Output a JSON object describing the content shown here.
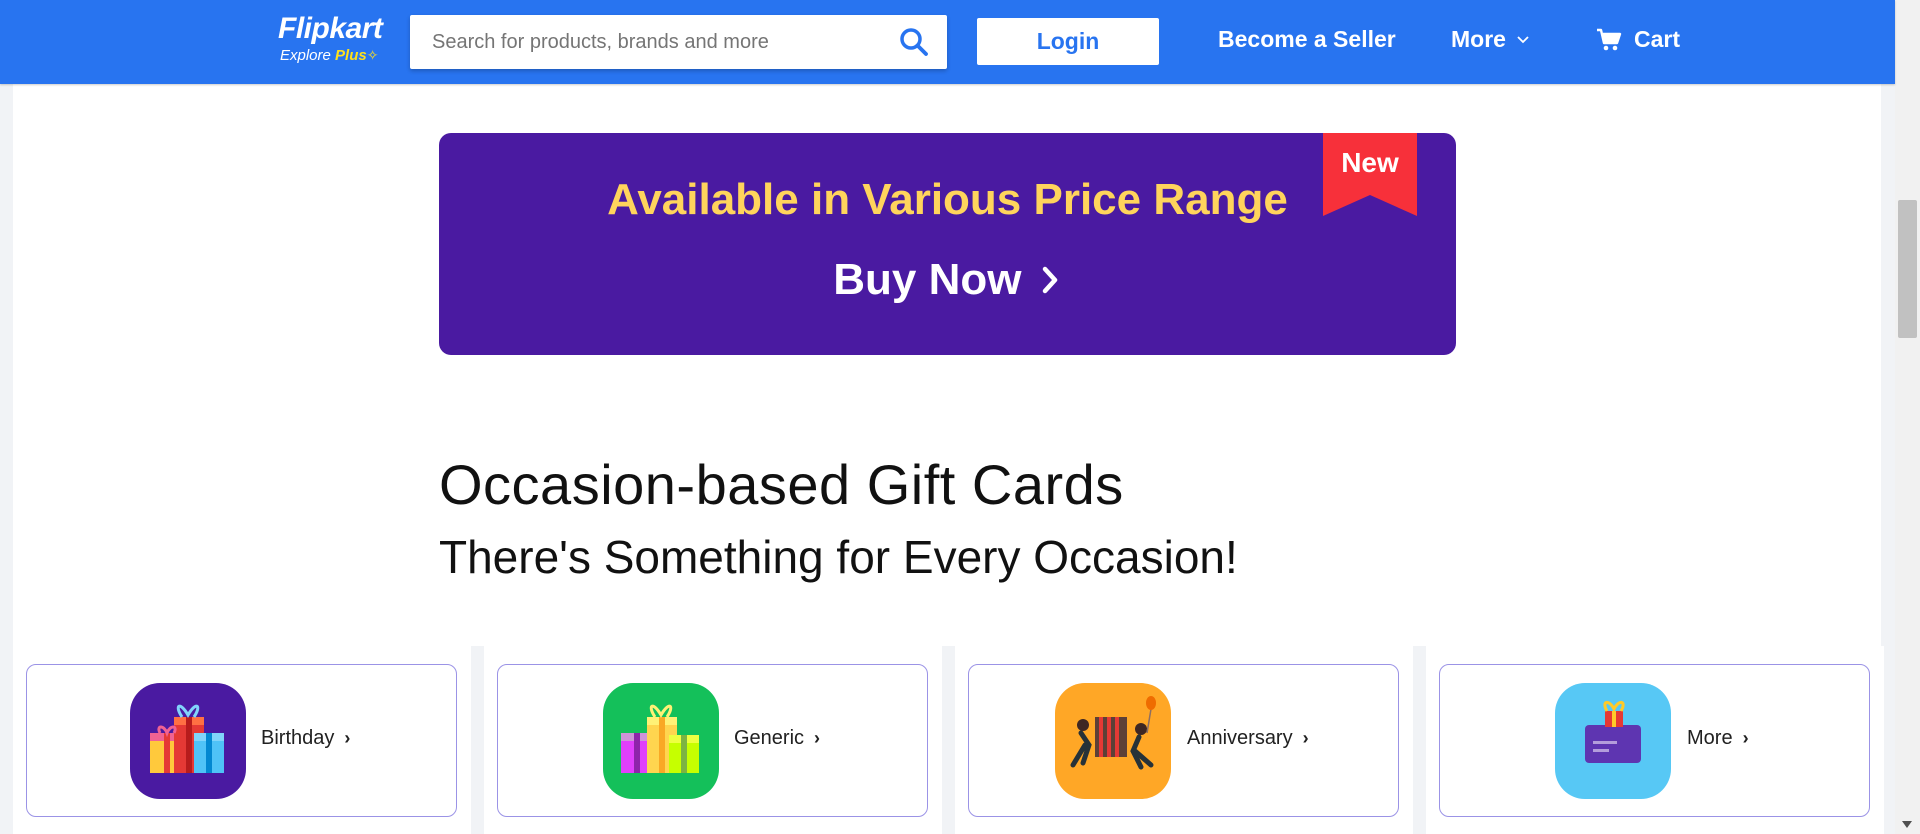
{
  "header": {
    "logo": {
      "brand": "Flipkart",
      "tagline": "Explore",
      "tagline_plus": "Plus"
    },
    "search": {
      "placeholder": "Search for products, brands and more"
    },
    "login_label": "Login",
    "seller_label": "Become a Seller",
    "more_label": "More",
    "cart_label": "Cart",
    "accent": "#2874f0"
  },
  "banner": {
    "title": "Available in Various Price Range",
    "cta": "Buy Now",
    "ribbon": "New",
    "background": "#4a1aa1",
    "title_color": "#ffd45c",
    "ribbon_color": "#f7303a"
  },
  "section": {
    "title": "Occasion-based Gift Cards",
    "subtitle": "There's Something for Every Occasion!"
  },
  "occasions": [
    {
      "label": "Birthday",
      "icon": "gift-boxes-icon",
      "color": "#4a1aa1"
    },
    {
      "label": "Generic",
      "icon": "gift-boxes-icon",
      "color": "#14c05a"
    },
    {
      "label": "Anniversary",
      "icon": "couple-gift-icon",
      "color": "#ffa726"
    },
    {
      "label": "More",
      "icon": "gift-card-icon",
      "color": "#57c8f5"
    }
  ]
}
